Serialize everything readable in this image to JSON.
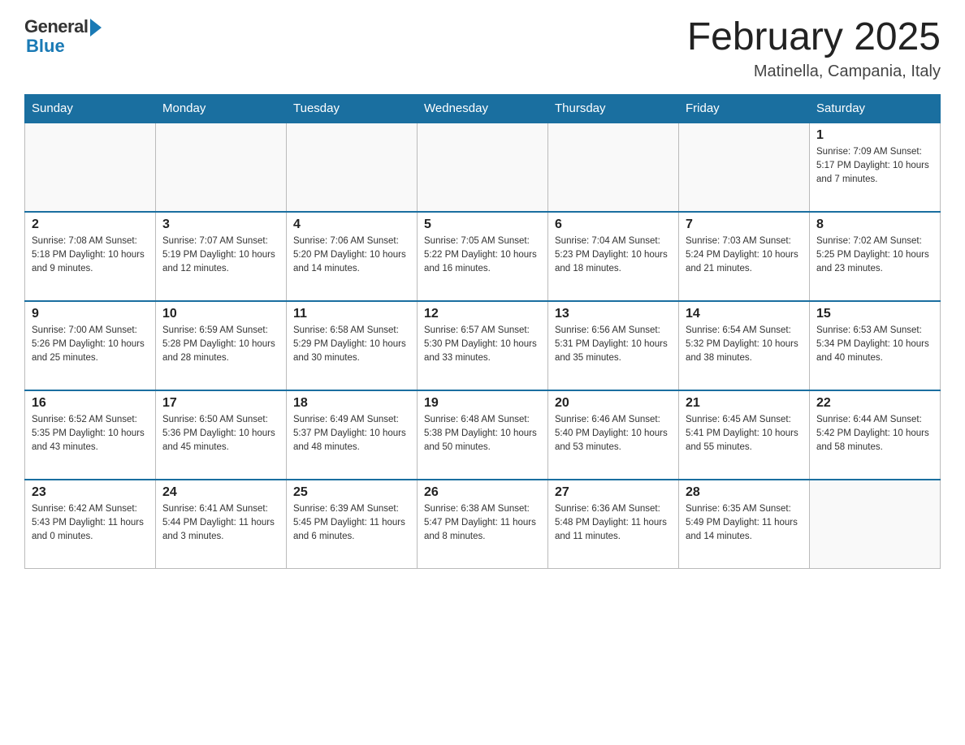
{
  "header": {
    "title": "February 2025",
    "location": "Matinella, Campania, Italy",
    "logo_general": "General",
    "logo_blue": "Blue"
  },
  "days_of_week": [
    "Sunday",
    "Monday",
    "Tuesday",
    "Wednesday",
    "Thursday",
    "Friday",
    "Saturday"
  ],
  "weeks": [
    [
      {
        "day": "",
        "info": ""
      },
      {
        "day": "",
        "info": ""
      },
      {
        "day": "",
        "info": ""
      },
      {
        "day": "",
        "info": ""
      },
      {
        "day": "",
        "info": ""
      },
      {
        "day": "",
        "info": ""
      },
      {
        "day": "1",
        "info": "Sunrise: 7:09 AM\nSunset: 5:17 PM\nDaylight: 10 hours and 7 minutes."
      }
    ],
    [
      {
        "day": "2",
        "info": "Sunrise: 7:08 AM\nSunset: 5:18 PM\nDaylight: 10 hours and 9 minutes."
      },
      {
        "day": "3",
        "info": "Sunrise: 7:07 AM\nSunset: 5:19 PM\nDaylight: 10 hours and 12 minutes."
      },
      {
        "day": "4",
        "info": "Sunrise: 7:06 AM\nSunset: 5:20 PM\nDaylight: 10 hours and 14 minutes."
      },
      {
        "day": "5",
        "info": "Sunrise: 7:05 AM\nSunset: 5:22 PM\nDaylight: 10 hours and 16 minutes."
      },
      {
        "day": "6",
        "info": "Sunrise: 7:04 AM\nSunset: 5:23 PM\nDaylight: 10 hours and 18 minutes."
      },
      {
        "day": "7",
        "info": "Sunrise: 7:03 AM\nSunset: 5:24 PM\nDaylight: 10 hours and 21 minutes."
      },
      {
        "day": "8",
        "info": "Sunrise: 7:02 AM\nSunset: 5:25 PM\nDaylight: 10 hours and 23 minutes."
      }
    ],
    [
      {
        "day": "9",
        "info": "Sunrise: 7:00 AM\nSunset: 5:26 PM\nDaylight: 10 hours and 25 minutes."
      },
      {
        "day": "10",
        "info": "Sunrise: 6:59 AM\nSunset: 5:28 PM\nDaylight: 10 hours and 28 minutes."
      },
      {
        "day": "11",
        "info": "Sunrise: 6:58 AM\nSunset: 5:29 PM\nDaylight: 10 hours and 30 minutes."
      },
      {
        "day": "12",
        "info": "Sunrise: 6:57 AM\nSunset: 5:30 PM\nDaylight: 10 hours and 33 minutes."
      },
      {
        "day": "13",
        "info": "Sunrise: 6:56 AM\nSunset: 5:31 PM\nDaylight: 10 hours and 35 minutes."
      },
      {
        "day": "14",
        "info": "Sunrise: 6:54 AM\nSunset: 5:32 PM\nDaylight: 10 hours and 38 minutes."
      },
      {
        "day": "15",
        "info": "Sunrise: 6:53 AM\nSunset: 5:34 PM\nDaylight: 10 hours and 40 minutes."
      }
    ],
    [
      {
        "day": "16",
        "info": "Sunrise: 6:52 AM\nSunset: 5:35 PM\nDaylight: 10 hours and 43 minutes."
      },
      {
        "day": "17",
        "info": "Sunrise: 6:50 AM\nSunset: 5:36 PM\nDaylight: 10 hours and 45 minutes."
      },
      {
        "day": "18",
        "info": "Sunrise: 6:49 AM\nSunset: 5:37 PM\nDaylight: 10 hours and 48 minutes."
      },
      {
        "day": "19",
        "info": "Sunrise: 6:48 AM\nSunset: 5:38 PM\nDaylight: 10 hours and 50 minutes."
      },
      {
        "day": "20",
        "info": "Sunrise: 6:46 AM\nSunset: 5:40 PM\nDaylight: 10 hours and 53 minutes."
      },
      {
        "day": "21",
        "info": "Sunrise: 6:45 AM\nSunset: 5:41 PM\nDaylight: 10 hours and 55 minutes."
      },
      {
        "day": "22",
        "info": "Sunrise: 6:44 AM\nSunset: 5:42 PM\nDaylight: 10 hours and 58 minutes."
      }
    ],
    [
      {
        "day": "23",
        "info": "Sunrise: 6:42 AM\nSunset: 5:43 PM\nDaylight: 11 hours and 0 minutes."
      },
      {
        "day": "24",
        "info": "Sunrise: 6:41 AM\nSunset: 5:44 PM\nDaylight: 11 hours and 3 minutes."
      },
      {
        "day": "25",
        "info": "Sunrise: 6:39 AM\nSunset: 5:45 PM\nDaylight: 11 hours and 6 minutes."
      },
      {
        "day": "26",
        "info": "Sunrise: 6:38 AM\nSunset: 5:47 PM\nDaylight: 11 hours and 8 minutes."
      },
      {
        "day": "27",
        "info": "Sunrise: 6:36 AM\nSunset: 5:48 PM\nDaylight: 11 hours and 11 minutes."
      },
      {
        "day": "28",
        "info": "Sunrise: 6:35 AM\nSunset: 5:49 PM\nDaylight: 11 hours and 14 minutes."
      },
      {
        "day": "",
        "info": ""
      }
    ]
  ]
}
